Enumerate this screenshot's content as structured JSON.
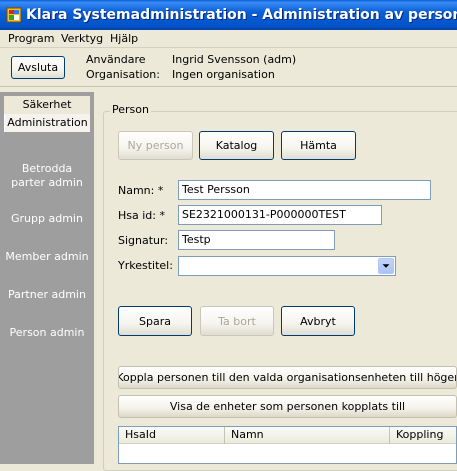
{
  "window": {
    "title": "Klara Systemadministration - Administration av personer",
    "icon": "app-icon"
  },
  "menu": {
    "items": [
      "Program",
      "Verktyg",
      "Hjälp"
    ]
  },
  "infobar": {
    "quit_label": "Avsluta",
    "user_label": "Användare",
    "user_value": "Ingrid Svensson (adm)",
    "org_label": "Organisation:",
    "org_value": "Ingen organisation"
  },
  "sidebar": {
    "tabs": [
      "Säkerhet",
      "Administration"
    ],
    "active_tab": "Administration",
    "items": [
      "Betrodda parter admin",
      "Grupp admin",
      "Member admin",
      "Partner admin",
      "Person admin"
    ]
  },
  "person": {
    "group_title": "Person",
    "buttons": {
      "new": "Ny person",
      "catalog": "Katalog",
      "fetch": "Hämta"
    },
    "fields": {
      "name_label": "Namn: *",
      "name_value": "Test Persson",
      "hsa_label": "Hsa id: *",
      "hsa_value": "SE2321000131-P000000TEST",
      "signature_label": "Signatur:",
      "signature_value": "Testp",
      "title_label": "Yrkestitel:",
      "title_value": ""
    },
    "actions": {
      "save": "Spara",
      "delete": "Ta bort",
      "cancel": "Avbryt"
    },
    "link_button": "Koppla personen till den valda organisationsenheten till höger",
    "show_units_button": "Visa de enheter som personen kopplats till",
    "grid_columns": [
      "HsaId",
      "Namn",
      "Koppling"
    ]
  },
  "colors": {
    "titlebar": "#0a5fd8",
    "sidebar": "#9e9e9e",
    "window": "#ece9d8"
  }
}
